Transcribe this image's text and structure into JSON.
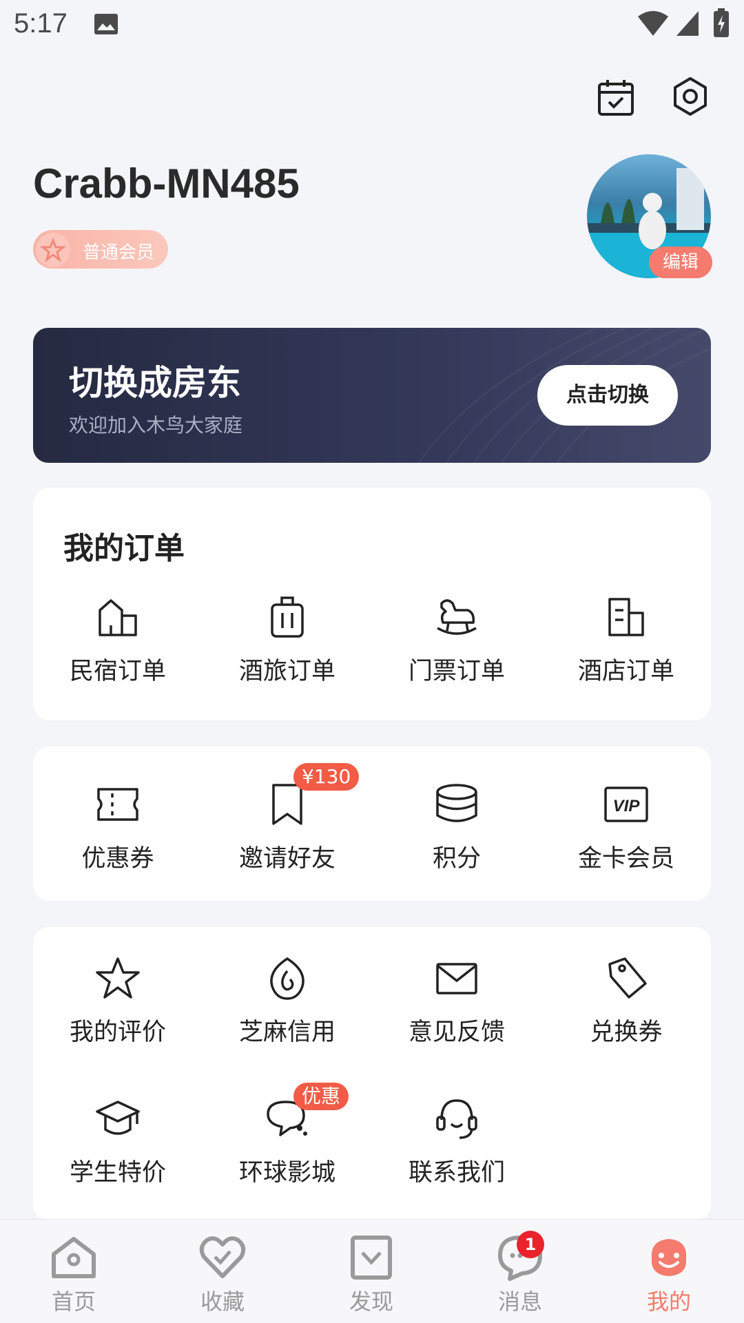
{
  "status_bar": {
    "time": "5:17"
  },
  "profile": {
    "username": "Crabb-MN485",
    "member_level": "普通会员",
    "edit_label": "编辑"
  },
  "host_banner": {
    "title": "切换成房东",
    "subtitle": "欢迎加入木鸟大家庭",
    "button_label": "点击切换"
  },
  "orders": {
    "title": "我的订单",
    "items": [
      {
        "label": "民宿订单",
        "icon": "homestay-icon"
      },
      {
        "label": "酒旅订单",
        "icon": "luggage-icon"
      },
      {
        "label": "门票订单",
        "icon": "rocking-horse-icon"
      },
      {
        "label": "酒店订单",
        "icon": "hotel-icon"
      }
    ]
  },
  "tools": {
    "items": [
      {
        "label": "优惠券",
        "icon": "coupon-icon"
      },
      {
        "label": "邀请好友",
        "icon": "bookmark-icon",
        "badge": "¥130"
      },
      {
        "label": "积分",
        "icon": "points-icon"
      },
      {
        "label": "金卡会员",
        "icon": "vip-icon",
        "icon_text": "VIP"
      }
    ]
  },
  "services": {
    "items": [
      {
        "label": "我的评价",
        "icon": "star-icon"
      },
      {
        "label": "芝麻信用",
        "icon": "sesame-credit-icon"
      },
      {
        "label": "意见反馈",
        "icon": "mail-icon"
      },
      {
        "label": "兑换券",
        "icon": "tag-icon"
      },
      {
        "label": "学生特价",
        "icon": "graduation-cap-icon"
      },
      {
        "label": "环球影城",
        "icon": "chat-bubbles-icon",
        "badge": "优惠"
      },
      {
        "label": "联系我们",
        "icon": "headset-icon"
      }
    ]
  },
  "bottom_nav": {
    "items": [
      {
        "label": "首页",
        "icon": "home-icon",
        "active": false
      },
      {
        "label": "收藏",
        "icon": "heart-icon",
        "active": false
      },
      {
        "label": "发现",
        "icon": "discover-icon",
        "active": false
      },
      {
        "label": "消息",
        "icon": "message-icon",
        "active": false,
        "badge": "1"
      },
      {
        "label": "我的",
        "icon": "profile-face-icon",
        "active": true
      }
    ]
  },
  "colors": {
    "accent": "#f47b6d",
    "badge_red": "#f25b45",
    "banner_dark": "#2a2f4a",
    "inactive_nav": "#9a9a9a"
  }
}
